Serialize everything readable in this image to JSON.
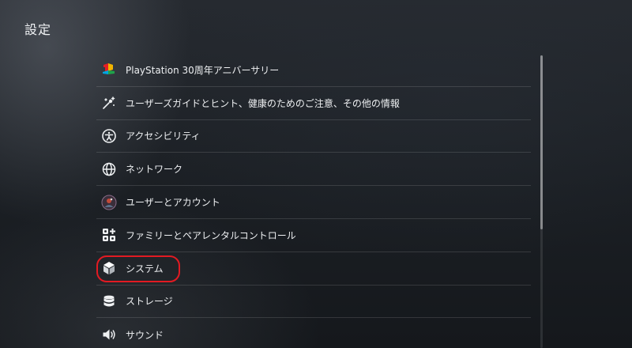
{
  "header": {
    "title": "設定"
  },
  "menu": {
    "items": [
      {
        "label": "PlayStation 30周年アニバーサリー",
        "icon": "playstation-logo-icon"
      },
      {
        "label": "ユーザーズガイドとヒント、健康のためのご注意、その他の情報",
        "icon": "user-guide-icon"
      },
      {
        "label": "アクセシビリティ",
        "icon": "accessibility-icon"
      },
      {
        "label": "ネットワーク",
        "icon": "globe-icon"
      },
      {
        "label": "ユーザーとアカウント",
        "icon": "user-avatar-icon"
      },
      {
        "label": "ファミリーとペアレンタルコントロール",
        "icon": "family-icon"
      },
      {
        "label": "システム",
        "icon": "cube-icon",
        "highlighted": true
      },
      {
        "label": "ストレージ",
        "icon": "storage-icon"
      },
      {
        "label": "サウンド",
        "icon": "speaker-icon"
      }
    ]
  },
  "colors": {
    "highlight": "#e21a22",
    "text": "#eef0f2"
  }
}
